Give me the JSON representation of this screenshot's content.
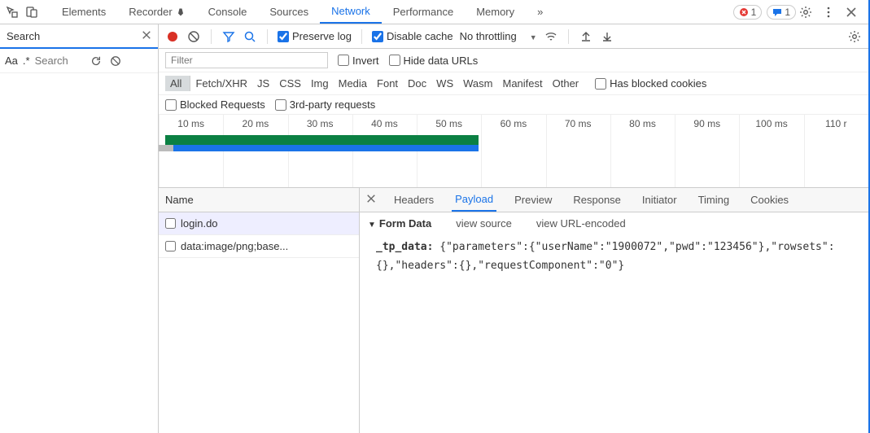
{
  "top_tabs": {
    "items": [
      "Elements",
      "Recorder",
      "Console",
      "Sources",
      "Network",
      "Performance",
      "Memory"
    ],
    "more_glyph": "»",
    "active_index": 4,
    "errors": "1",
    "messages": "1"
  },
  "search_panel": {
    "title": "Search",
    "placeholder": "Search",
    "aa": "Aa",
    "regex": ".*"
  },
  "toolbar": {
    "preserve_log": "Preserve log",
    "disable_cache": "Disable cache",
    "throttling": "No throttling"
  },
  "filter": {
    "placeholder": "Filter",
    "invert": "Invert",
    "hide_urls": "Hide data URLs",
    "types": [
      "All",
      "Fetch/XHR",
      "JS",
      "CSS",
      "Img",
      "Media",
      "Font",
      "Doc",
      "WS",
      "Wasm",
      "Manifest",
      "Other"
    ],
    "has_blocked": "Has blocked cookies",
    "blocked_req": "Blocked Requests",
    "third_party": "3rd-party requests"
  },
  "waterfall": {
    "ticks": [
      "10 ms",
      "20 ms",
      "30 ms",
      "40 ms",
      "50 ms",
      "60 ms",
      "70 ms",
      "80 ms",
      "90 ms",
      "100 ms",
      "110 r"
    ]
  },
  "requests": {
    "header": "Name",
    "items": [
      "login.do",
      "data:image/png;base..."
    ]
  },
  "detail": {
    "tabs": [
      "Headers",
      "Payload",
      "Preview",
      "Response",
      "Initiator",
      "Timing",
      "Cookies"
    ],
    "active_index": 1,
    "group": "Form Data",
    "view_source": "view source",
    "view_urlencoded": "view URL-encoded",
    "payload_key": "_tp_data:",
    "payload_line1": "{\"parameters\":{\"userName\":\"1900072\",\"pwd\":\"123456\"},\"rowsets\":",
    "payload_line2": "{},\"headers\":{},\"requestComponent\":\"0\"}"
  }
}
